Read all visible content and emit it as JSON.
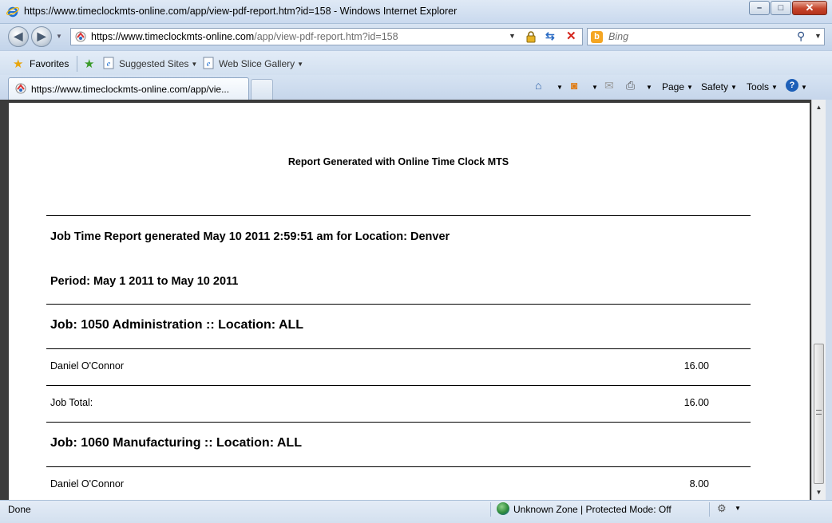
{
  "window": {
    "title": "https://www.timeclockmts-online.com/app/view-pdf-report.htm?id=158 - Windows Internet Explorer",
    "controls": {
      "minimize": "–",
      "maximize": "□",
      "close": "✕"
    }
  },
  "address": {
    "url_host": "https://www.timeclockmts-online.com",
    "url_path": "/app/view-pdf-report.htm?id=158",
    "search_placeholder": "Bing",
    "search_provider_icon": "b"
  },
  "favorites_bar": {
    "favorites_label": "Favorites",
    "items": [
      {
        "label": "Suggested Sites"
      },
      {
        "label": "Web Slice Gallery"
      }
    ]
  },
  "tabs": {
    "active_label": "https://www.timeclockmts-online.com/app/vie..."
  },
  "command_bar": {
    "page_label": "Page",
    "safety_label": "Safety",
    "tools_label": "Tools"
  },
  "report": {
    "header": "Report Generated with Online Time Clock MTS",
    "title_line": "Job Time Report generated May 10 2011 2:59:51 am for Location: Denver",
    "period_line": "Period: May 1 2011 to May 10 2011",
    "jobs": [
      {
        "heading": "Job: 1050 Administration :: Location: ALL",
        "rows": [
          {
            "name": "Daniel O'Connor",
            "hours": "16.00"
          },
          {
            "name": "Job Total:",
            "hours": "16.00"
          }
        ]
      },
      {
        "heading": "Job: 1060 Manufacturing :: Location: ALL",
        "rows": [
          {
            "name": "Daniel O'Connor",
            "hours": "8.00"
          }
        ]
      }
    ]
  },
  "status_bar": {
    "status": "Done",
    "zone": "Unknown Zone | Protected Mode: Off"
  },
  "colors": {
    "chrome": "#cfdcec",
    "page_frame": "#3b3b3b",
    "close_button": "#c5442b"
  }
}
